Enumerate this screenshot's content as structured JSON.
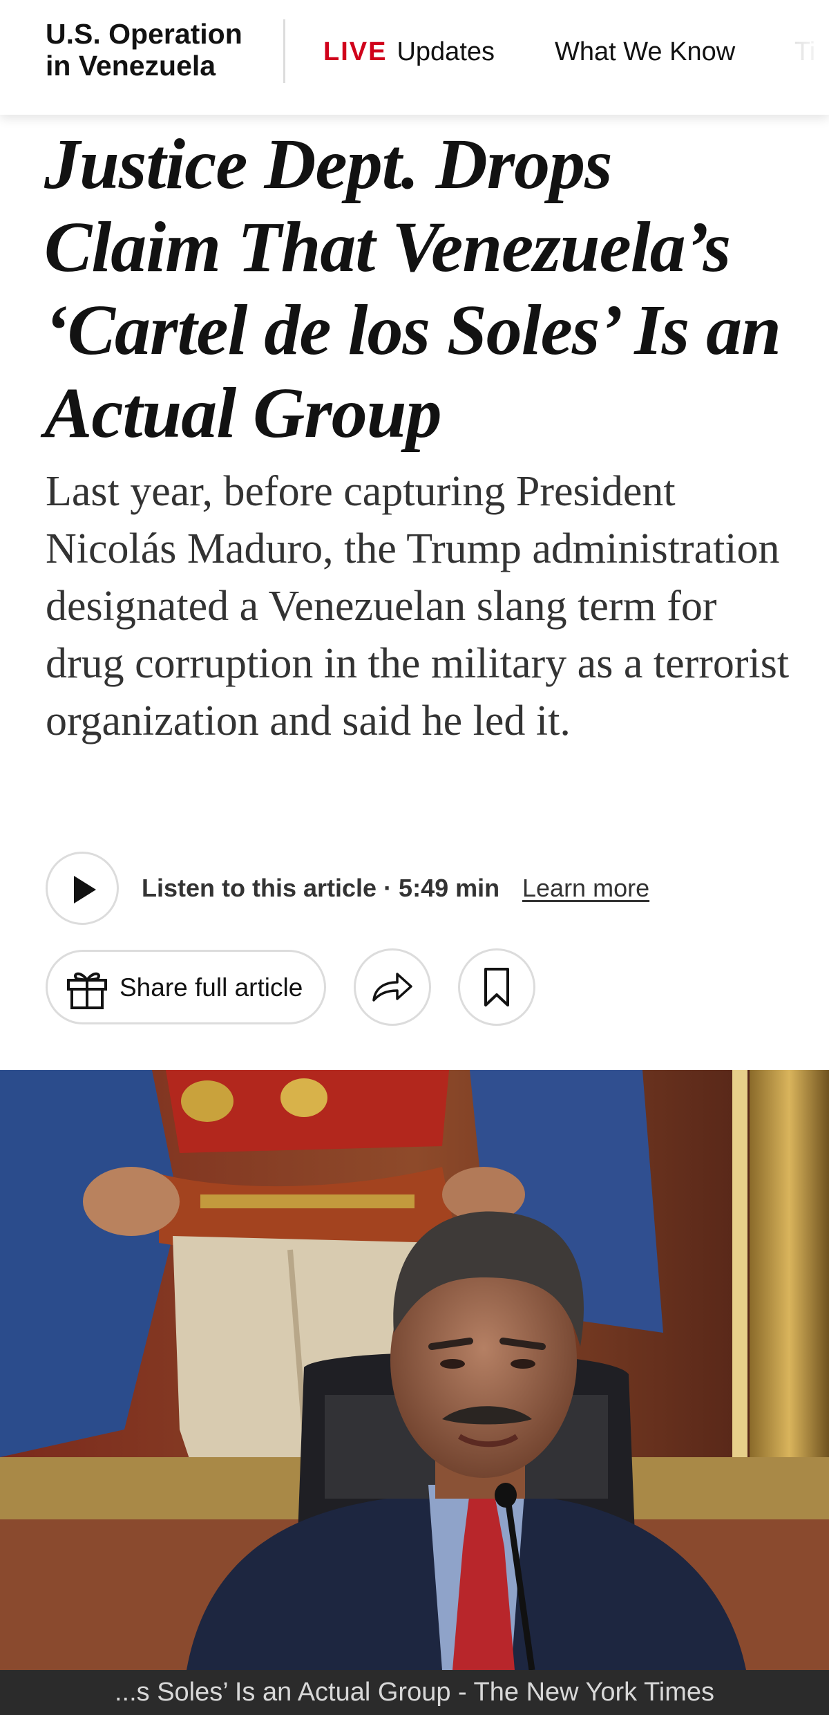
{
  "nav": {
    "section_title": "U.S. Operation in Venezuela",
    "live_badge": "LIVE",
    "live_label": "Updates",
    "what_we_know": "What We Know",
    "timeline_partial": "Ti"
  },
  "article": {
    "headline": "Justice Dept. Drops Claim That Venezuela’s ‘Cartel de los Soles’ Is an Actual Group",
    "summary": "Last year, before capturing President Nicolás Maduro, the Trump administration designated a Venezuelan slang term for drug corruption in the military as a terrorist organization and said he led it."
  },
  "audio": {
    "listen_label": "Listen to this article · 5:49 min",
    "learn_more": "Learn more"
  },
  "actions": {
    "share_label": "Share full article"
  },
  "browser": {
    "page_title": "...s Soles’ Is an Actual Group - The New York Times"
  },
  "icons": {
    "play": "play-icon",
    "gift": "gift-icon",
    "forward": "forward-arrow-icon",
    "bookmark": "bookmark-icon"
  },
  "colors": {
    "live_red": "#d0021b",
    "text": "#121212",
    "summary_text": "#333333",
    "border": "#dcdcdc",
    "title_bar": "#2b2b2b"
  }
}
